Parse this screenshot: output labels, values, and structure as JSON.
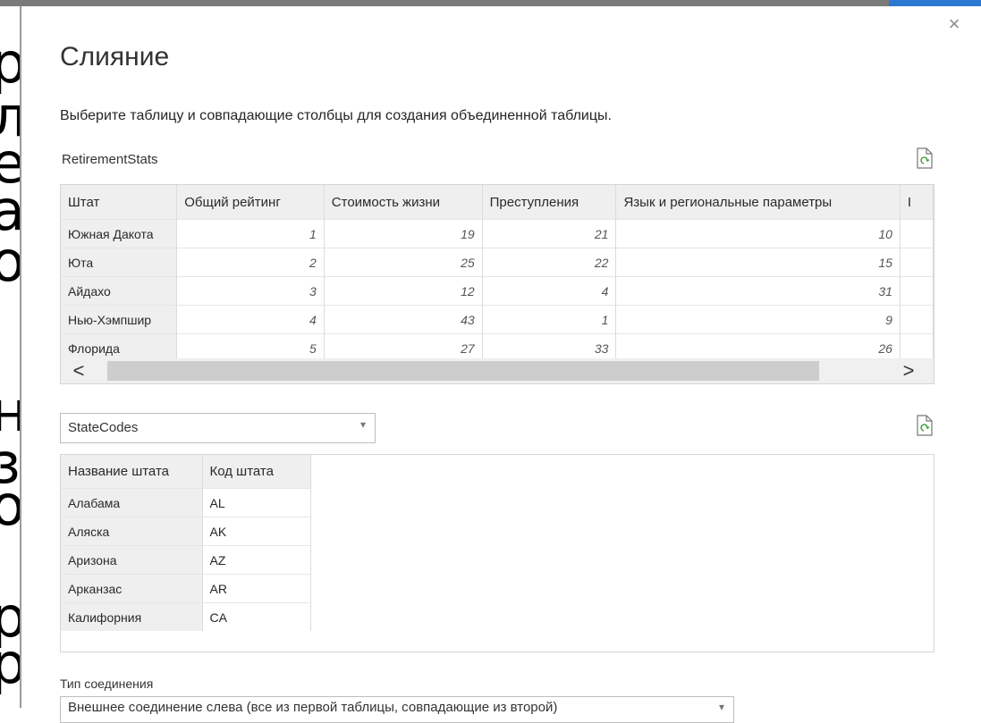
{
  "dialog": {
    "title": "Слияние",
    "description": "Выберите таблицу и совпадающие столбцы для создания объединенной таблицы.",
    "close_glyph": "×"
  },
  "table1": {
    "name": "RetirementStats",
    "columns": [
      "Штат",
      "Общий рейтинг",
      "Стоимость жизни",
      "Преступления",
      "Язык и региональные параметры",
      "I"
    ],
    "rows": [
      [
        "Южная Дакота",
        "1",
        "19",
        "21",
        "10"
      ],
      [
        "Юта",
        "2",
        "25",
        "22",
        "15"
      ],
      [
        "Айдахо",
        "3",
        "12",
        "4",
        "31"
      ],
      [
        "Нью-Хэмпшир",
        "4",
        "43",
        "1",
        "9"
      ],
      [
        "Флорида",
        "5",
        "27",
        "33",
        "26"
      ]
    ],
    "scroll_left": "<",
    "scroll_right": ">"
  },
  "table2": {
    "selected": "StateCodes",
    "columns": [
      "Название штата",
      "Код штата"
    ],
    "rows": [
      [
        "Алабама",
        "AL"
      ],
      [
        "Аляска",
        "AK"
      ],
      [
        "Аризона",
        "AZ"
      ],
      [
        "Арканзас",
        "AR"
      ],
      [
        "Калифорния",
        "CA"
      ]
    ]
  },
  "join": {
    "label": "Тип соединения",
    "selected": "Внешнее соединение слева (все из первой таблицы, совпадающие из второй)"
  },
  "background_glyphs": [
    "р",
    "л",
    "е",
    "а",
    "о",
    "н",
    "з",
    "о",
    "р",
    "р"
  ],
  "icons": [
    "refresh-file-icon",
    "close-icon",
    "chevron-down-icon"
  ]
}
